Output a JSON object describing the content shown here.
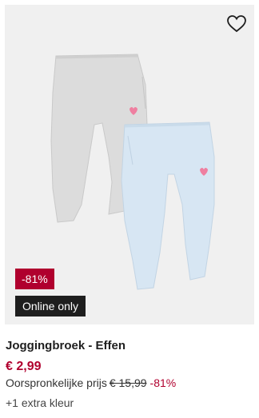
{
  "product": {
    "badges": {
      "discount": "-81%",
      "online": "Online only"
    },
    "title": "Joggingbroek - Effen",
    "price": "€ 2,99",
    "original_label": "Oorspronkelijke prijs",
    "original_price": "€ 15,99",
    "discount_pct": "-81%",
    "extra_colors": "+1 extra kleur",
    "icons": {
      "wishlist": "heart-outline-icon"
    },
    "colors": {
      "accent": "#b0002e",
      "online_badge": "#1e1e1e",
      "image_bg": "#f0f0f0",
      "pants_grey": "#dcdcdc",
      "pants_blue": "#d7e6f3",
      "heart_pink": "#ef7fa0"
    }
  }
}
